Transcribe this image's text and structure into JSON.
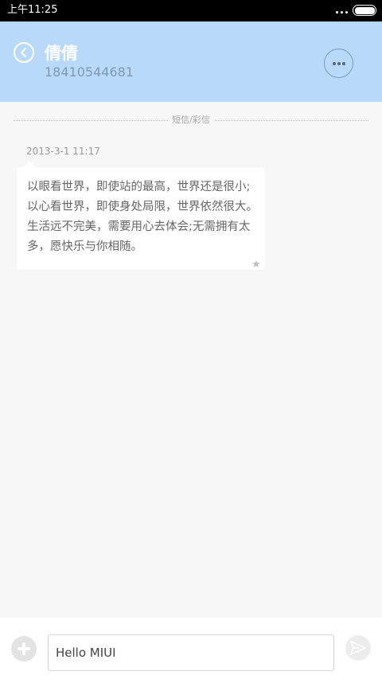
{
  "status_bar": {
    "time": "上午11:25"
  },
  "header": {
    "contact_name": "倩倩",
    "contact_number": "18410544681"
  },
  "conversation": {
    "divider_label": "短信/彩信",
    "message": {
      "timestamp": "2013-3-1 11:17",
      "body": "以眼看世界，即使站的最高，世界还是很小;以心看世界，即使身处局限，世界依然很大。生活远不完美，需要用心去体会;无需拥有太多，愿快乐与你相随。",
      "starred": true
    }
  },
  "composer": {
    "input_value": "Hello MIUI"
  },
  "colors": {
    "header_bg": "#b9d9fb",
    "status_bar_bg": "#000000",
    "page_bg": "#f7f7f7"
  },
  "icons": [
    "back-icon",
    "more-icon",
    "star-icon",
    "add-icon",
    "send-icon",
    "battery-icon"
  ]
}
